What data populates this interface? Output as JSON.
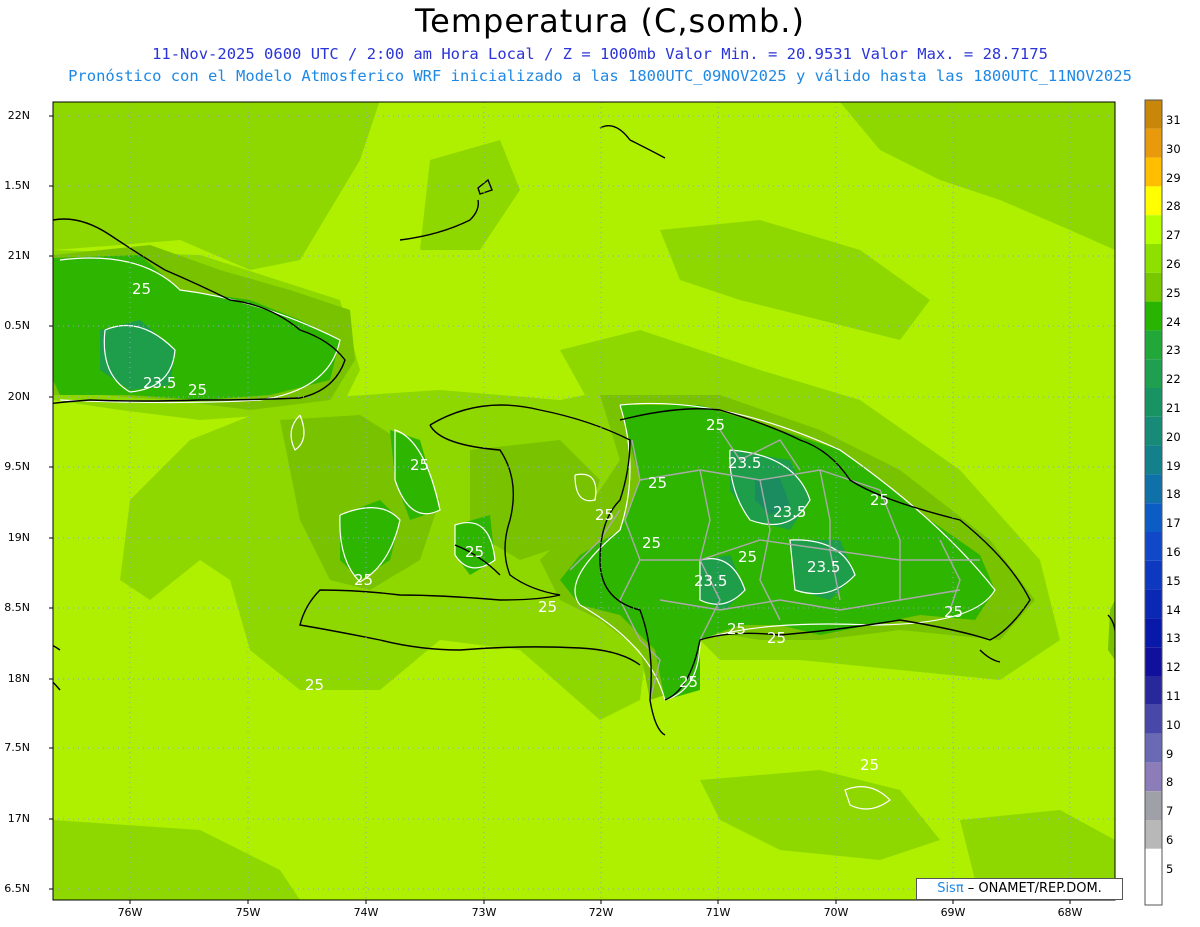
{
  "title": "Temperatura (C,somb.)",
  "subtitle1": "11-Nov-2025 0600 UTC / 2:00 am Hora Local / Z = 1000mb   Valor Min. = 20.9531  Valor Max. = 28.7175",
  "subtitle2": "Pronóstico con el Modelo Atmosferico WRF inicializado a las 1800UTC_09NOV2025 y válido hasta las  1800UTC_11NOV2025",
  "lat_labels": [
    "22N",
    "1.5N",
    "21N",
    "0.5N",
    "20N",
    "9.5N",
    "19N",
    "8.5N",
    "18N",
    "7.5N",
    "17N",
    "6.5N"
  ],
  "lon_labels": [
    "76W",
    "75W",
    "74W",
    "73W",
    "72W",
    "71W",
    "70W",
    "69W",
    "68W"
  ],
  "colorbar": {
    "values": [
      "31",
      "30",
      "29",
      "28",
      "27",
      "26",
      "25",
      "24",
      "23",
      "22",
      "21",
      "20",
      "19",
      "18",
      "17",
      "16",
      "15",
      "14",
      "13",
      "12",
      "11",
      "10",
      "9",
      "8",
      "7",
      "6",
      "5"
    ],
    "colors": [
      "#c8860a",
      "#e89a0c",
      "#ffbf00",
      "#ffff00",
      "#b6ff00",
      "#8ee000",
      "#78c800",
      "#28b400",
      "#22a838",
      "#1fa050",
      "#1a9364",
      "#178a78",
      "#13808c",
      "#1070a8",
      "#0b5cc4",
      "#1048c8",
      "#0d38c0",
      "#0a28b4",
      "#0818a8",
      "#10109c",
      "#28289c",
      "#4848a8",
      "#6a6ab4",
      "#8c7cb8",
      "#a0a0a8",
      "#b8b8b8",
      "#ffffff"
    ]
  },
  "contour_labels": [
    "25",
    "23.5",
    "25",
    "25",
    "25",
    "25",
    "25",
    "25",
    "25",
    "23.5",
    "25",
    "25",
    "23.5",
    "25",
    "23.5",
    "25",
    "23.5",
    "25",
    "25",
    "25",
    "25",
    "25",
    "25"
  ],
  "credit": {
    "sis": "Sisπ",
    "rest": " – ONAMET/REP.DOM."
  },
  "colors": {
    "background_field": "#aef000",
    "title": "#000000",
    "subtitle1": "#2a34d8",
    "subtitle2": "#1e88e5"
  }
}
